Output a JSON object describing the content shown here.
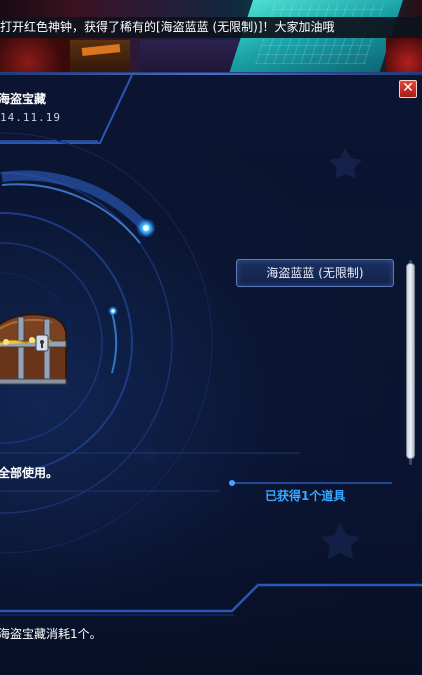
{
  "broadcast": {
    "text": "打开红色神钟，获得了稀有的[海盗蓝蓝 (无限制)]！大家加油哦"
  },
  "dialog": {
    "title": "海盗宝藏",
    "date": "14.11.19",
    "close_icon": "close-icon",
    "reward_item": "海盗蓝蓝 (无限制)",
    "use_all_text": "全部使用。",
    "obtained_text": "已获得1个道具",
    "footer_note": "海盗宝藏消耗1个。"
  },
  "colors": {
    "accent": "#3aa8ff",
    "panel_bg": "#0a1530",
    "close_red": "#c8281c"
  },
  "scrollbar": {
    "position": 0.0
  }
}
